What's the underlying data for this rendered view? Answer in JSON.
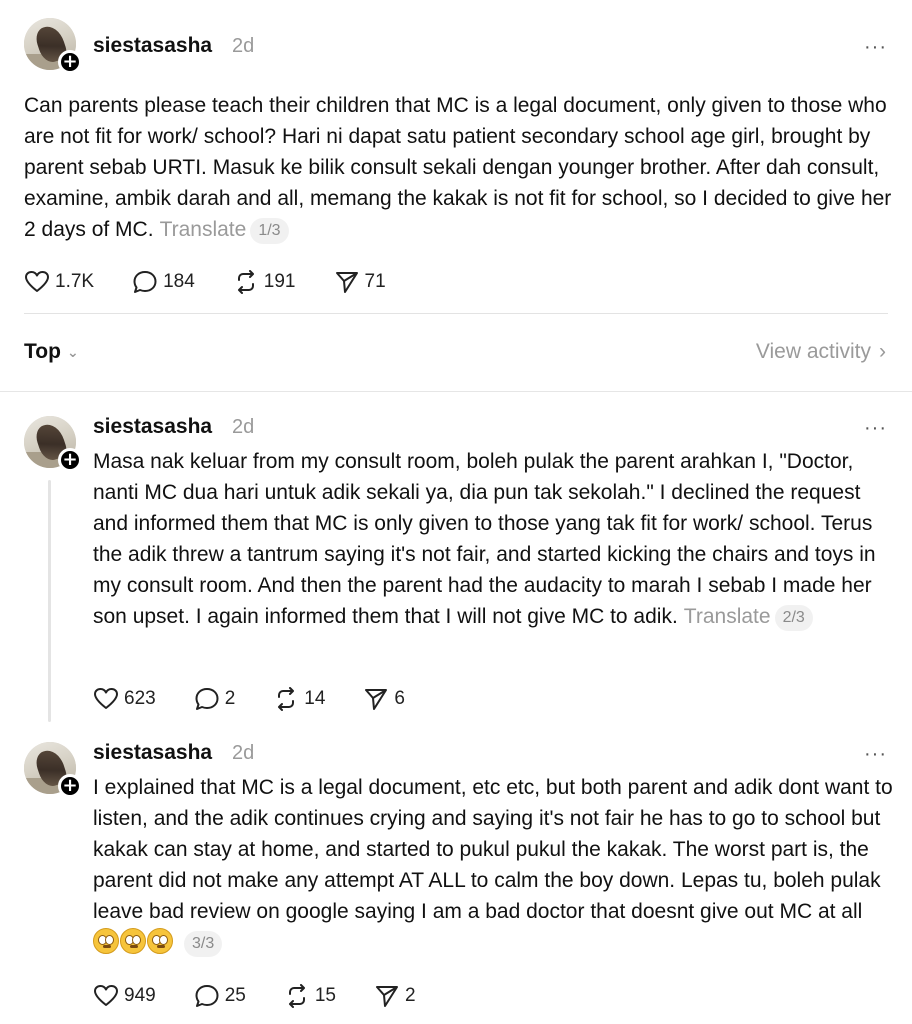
{
  "main_post": {
    "username": "siestasasha",
    "time": "2d",
    "more": "···",
    "text": "Can parents please teach their children that MC is a legal document, only given to those who are not fit for work/ school? Hari ni dapat satu patient secondary school age girl, brought by parent sebab URTI. Masuk ke bilik consult sekali dengan younger brother. After dah consult, examine, ambik darah and all, memang the kakak is not fit for school, so I decided to give her 2 days of MC.",
    "translate": "Translate",
    "page": "1/3",
    "likes": "1.7K",
    "replies": "184",
    "reposts": "191",
    "shares": "71"
  },
  "sort": {
    "label": "Top",
    "view_activity": "View activity"
  },
  "reply1": {
    "username": "siestasasha",
    "time": "2d",
    "more": "···",
    "text": "Masa nak keluar from my consult room, boleh pulak the parent arahkan I, \"Doctor, nanti MC dua hari untuk adik sekali ya, dia pun tak sekolah.\" I declined the request and informed them that MC is only given to those yang tak fit for work/ school. Terus the adik threw a tantrum saying it's not fair, and started kicking the chairs and toys in my consult room. And then the parent had the audacity to marah I sebab I made her son upset. I again informed them that I will not give MC to adik.",
    "translate": "Translate",
    "page": "2/3",
    "likes": "623",
    "replies": "2",
    "reposts": "14",
    "shares": "6"
  },
  "reply2": {
    "username": "siestasasha",
    "time": "2d",
    "more": "···",
    "text": "I explained that MC is a legal document, etc etc, but both parent and adik dont want to listen, and the adik continues crying and saying it's not fair he has to go to school but kakak can stay at home, and started to pukul pukul the kakak. The worst part is, the parent did not make any attempt AT ALL to calm the boy down. Lepas tu, boleh pulak leave bad review on google saying I am a bad doctor that doesnt give out MC at all",
    "emoji": "face-with-rolling-eyes",
    "page": "3/3",
    "likes": "949",
    "replies": "25",
    "reposts": "15",
    "shares": "2"
  }
}
